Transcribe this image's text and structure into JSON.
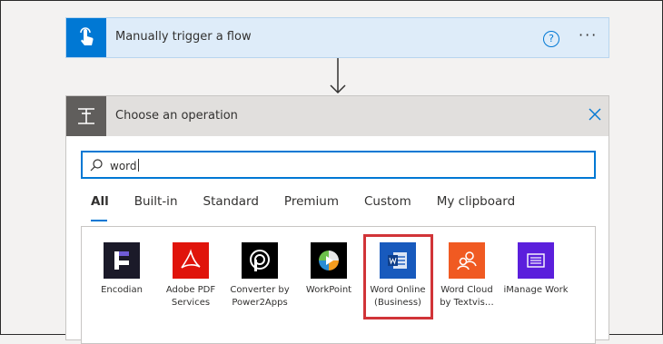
{
  "trigger": {
    "title": "Manually trigger a flow",
    "help_glyph": "?",
    "more_glyph": "···",
    "icon": "hand-touch-icon",
    "color": "#0078d4"
  },
  "operation": {
    "title": "Choose an operation",
    "icon": "operation-icon",
    "search": {
      "value": "word"
    },
    "tabs": [
      {
        "label": "All",
        "active": true
      },
      {
        "label": "Built-in",
        "active": false
      },
      {
        "label": "Standard",
        "active": false
      },
      {
        "label": "Premium",
        "active": false
      },
      {
        "label": "Custom",
        "active": false
      },
      {
        "label": "My clipboard",
        "active": false
      }
    ],
    "connectors": [
      {
        "label": "Encodian",
        "icon": "encodian-icon",
        "color": "#1b1a29"
      },
      {
        "label": "Adobe PDF Services",
        "icon": "adobe-pdf-icon",
        "color": "#e0140b"
      },
      {
        "label": "Converter by Power2Apps",
        "icon": "power2apps-icon",
        "color": "#000000"
      },
      {
        "label": "WorkPoint",
        "icon": "workpoint-icon",
        "color": "#000000"
      },
      {
        "label": "Word Online (Business)",
        "icon": "word-icon",
        "color": "#185abd",
        "highlighted": true
      },
      {
        "label": "Word Cloud by Textvis…",
        "icon": "word-cloud-icon",
        "color": "#f05a22"
      },
      {
        "label": "iManage Work",
        "icon": "imanage-icon",
        "color": "#5b1fdc"
      }
    ]
  }
}
